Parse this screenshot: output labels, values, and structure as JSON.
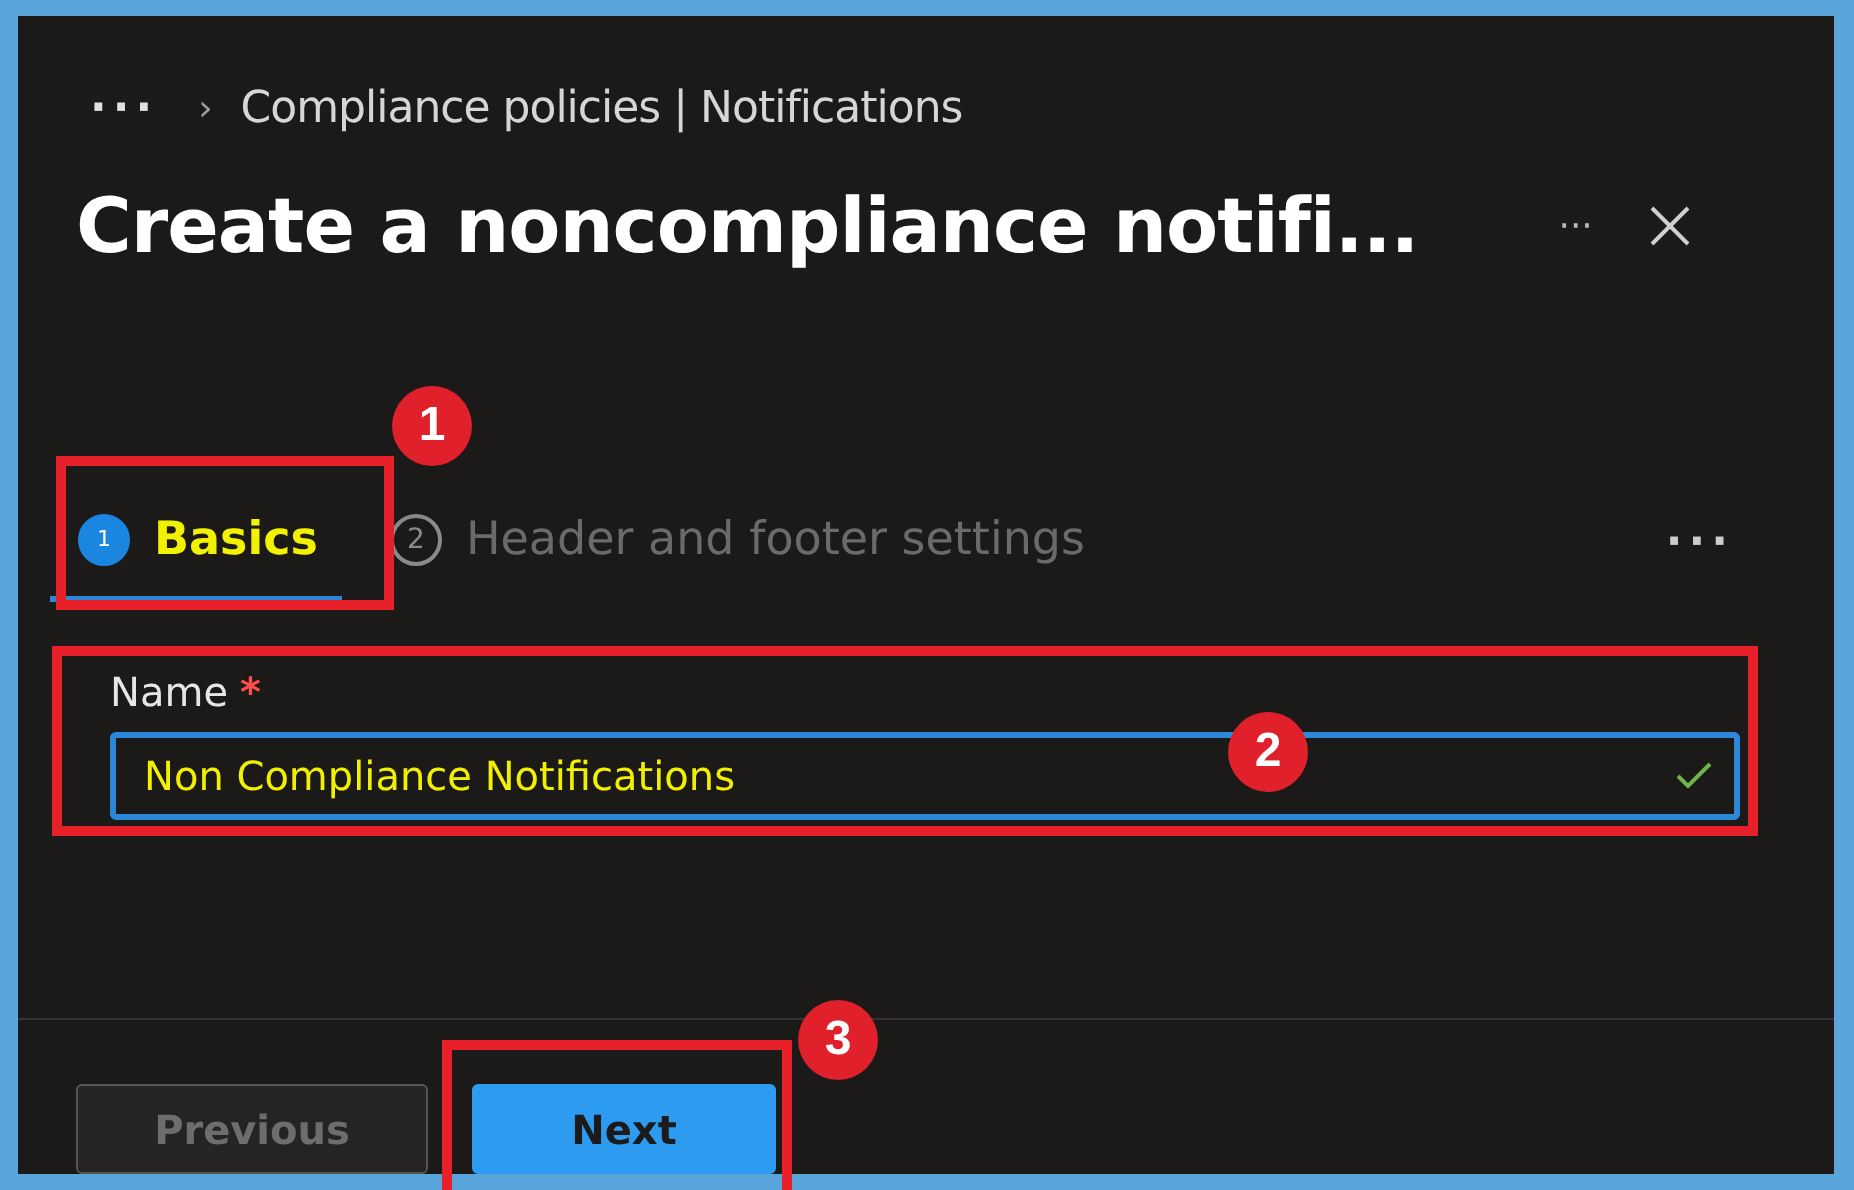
{
  "breadcrumb": {
    "overflow": "···",
    "separator": "›",
    "items": [
      "Compliance policies | Notifications"
    ]
  },
  "header": {
    "title": "Create a noncompliance notifi...",
    "more": "···"
  },
  "steps": [
    {
      "number": "1",
      "label": "Basics",
      "selected": true,
      "highlighted": true
    },
    {
      "number": "2",
      "label": "Header and footer settings",
      "selected": false,
      "highlighted": false
    }
  ],
  "steps_more": "···",
  "name_field": {
    "label": "Name",
    "required_mark": "*",
    "value": "Non Compliance Notifications",
    "highlighted": true,
    "valid": true
  },
  "buttons": [
    {
      "label": "Previous",
      "disabled": true,
      "primary": false
    },
    {
      "label": "Next",
      "disabled": false,
      "primary": true
    }
  ],
  "annotations": [
    {
      "number": "1"
    },
    {
      "number": "2"
    },
    {
      "number": "3"
    }
  ]
}
